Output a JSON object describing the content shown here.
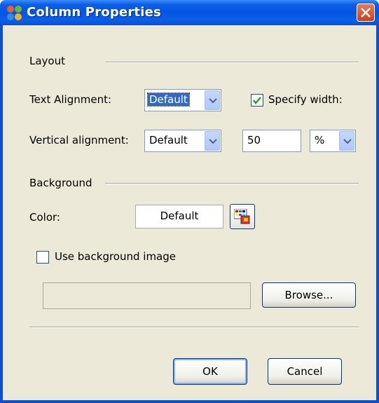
{
  "window": {
    "title": "Column Properties"
  },
  "layout_section": {
    "label": "Layout",
    "text_alignment": {
      "label": "Text Alignment:",
      "value": "Default"
    },
    "specify_width": {
      "label": "Specify width:",
      "checked": true
    },
    "vertical_alignment": {
      "label": "Vertical alignment:",
      "value": "Default"
    },
    "width_value": "50",
    "width_unit": "%"
  },
  "background_section": {
    "label": "Background",
    "color": {
      "label": "Color:",
      "value": "Default"
    },
    "use_image": {
      "label": "Use background image",
      "checked": false
    },
    "image_path": "",
    "browse_label": "Browse..."
  },
  "buttons": {
    "ok": "OK",
    "cancel": "Cancel"
  }
}
